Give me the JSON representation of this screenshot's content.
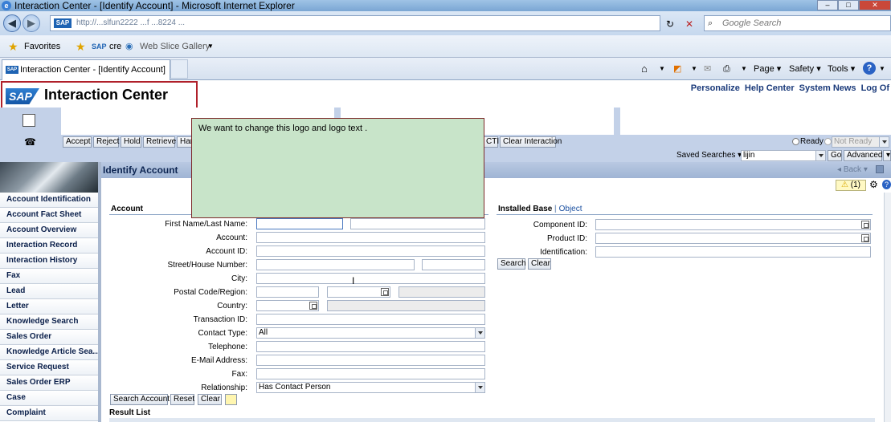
{
  "browser": {
    "title": "Interaction Center - [Identify Account] - Microsoft Internet Explorer",
    "address": "http://...slfun2222   ...f   ...8224   ...",
    "search_placeholder": "Google Search",
    "favorites_label": "Favorites",
    "fav_item_cre": "cre",
    "web_slice_gallery": "Web Slice Gallery",
    "tab_label": "Interaction Center - [Identify Account]",
    "commands": {
      "page": "Page",
      "safety": "Safety",
      "tools": "Tools"
    }
  },
  "header": {
    "logo_brand": "SAP",
    "logo_text": "Interaction Center",
    "links": [
      "Personalize",
      "Help Center",
      "System News",
      "Log Of"
    ]
  },
  "toolbar": {
    "buttons": [
      "Accept",
      "Reject",
      "Hold",
      "Retrieve",
      "Han"
    ],
    "cti_fragment": "CTI",
    "clear_interaction": "Clear Interaction",
    "ready": "Ready",
    "not_ready": "Not Ready"
  },
  "saved_searches": {
    "label": "Saved Searches",
    "value": "lijin",
    "go": "Go",
    "advanced": "Advanced"
  },
  "navigation": {
    "items": [
      "Account Identification",
      "Account Fact Sheet",
      "Account Overview",
      "Interaction Record",
      "Interaction History",
      "Fax",
      "Lead",
      "Letter",
      "Knowledge Search",
      "Sales Order",
      "Knowledge Article Sea...",
      "Service Request",
      "Sales Order ERP",
      "Case",
      "Complaint"
    ]
  },
  "page": {
    "title": "Identify Account",
    "back": "Back",
    "warning_count": "(1)"
  },
  "account": {
    "section_title": "Account",
    "fields": {
      "name": "First Name/Last Name:",
      "account": "Account:",
      "account_id": "Account ID:",
      "street": "Street/House Number:",
      "city": "City:",
      "postal": "Postal Code/Region:",
      "country": "Country:",
      "transaction_id": "Transaction ID:",
      "contact_type": "Contact Type:",
      "telephone": "Telephone:",
      "email": "E-Mail Address:",
      "fax": "Fax:",
      "relationship": "Relationship:"
    },
    "contact_type_value": "All",
    "relationship_value": "Has Contact Person",
    "buttons": {
      "search": "Search Account",
      "reset": "Reset",
      "clear": "Clear"
    }
  },
  "installed_base": {
    "tab_active": "Installed Base",
    "tab_object": "Object",
    "fields": {
      "component_id": "Component ID:",
      "product_id": "Product ID:",
      "identification": "Identification:"
    },
    "buttons": {
      "search": "Search",
      "clear": "Clear"
    }
  },
  "result_list": "Result List",
  "callout": "We want to change this logo and logo text ."
}
